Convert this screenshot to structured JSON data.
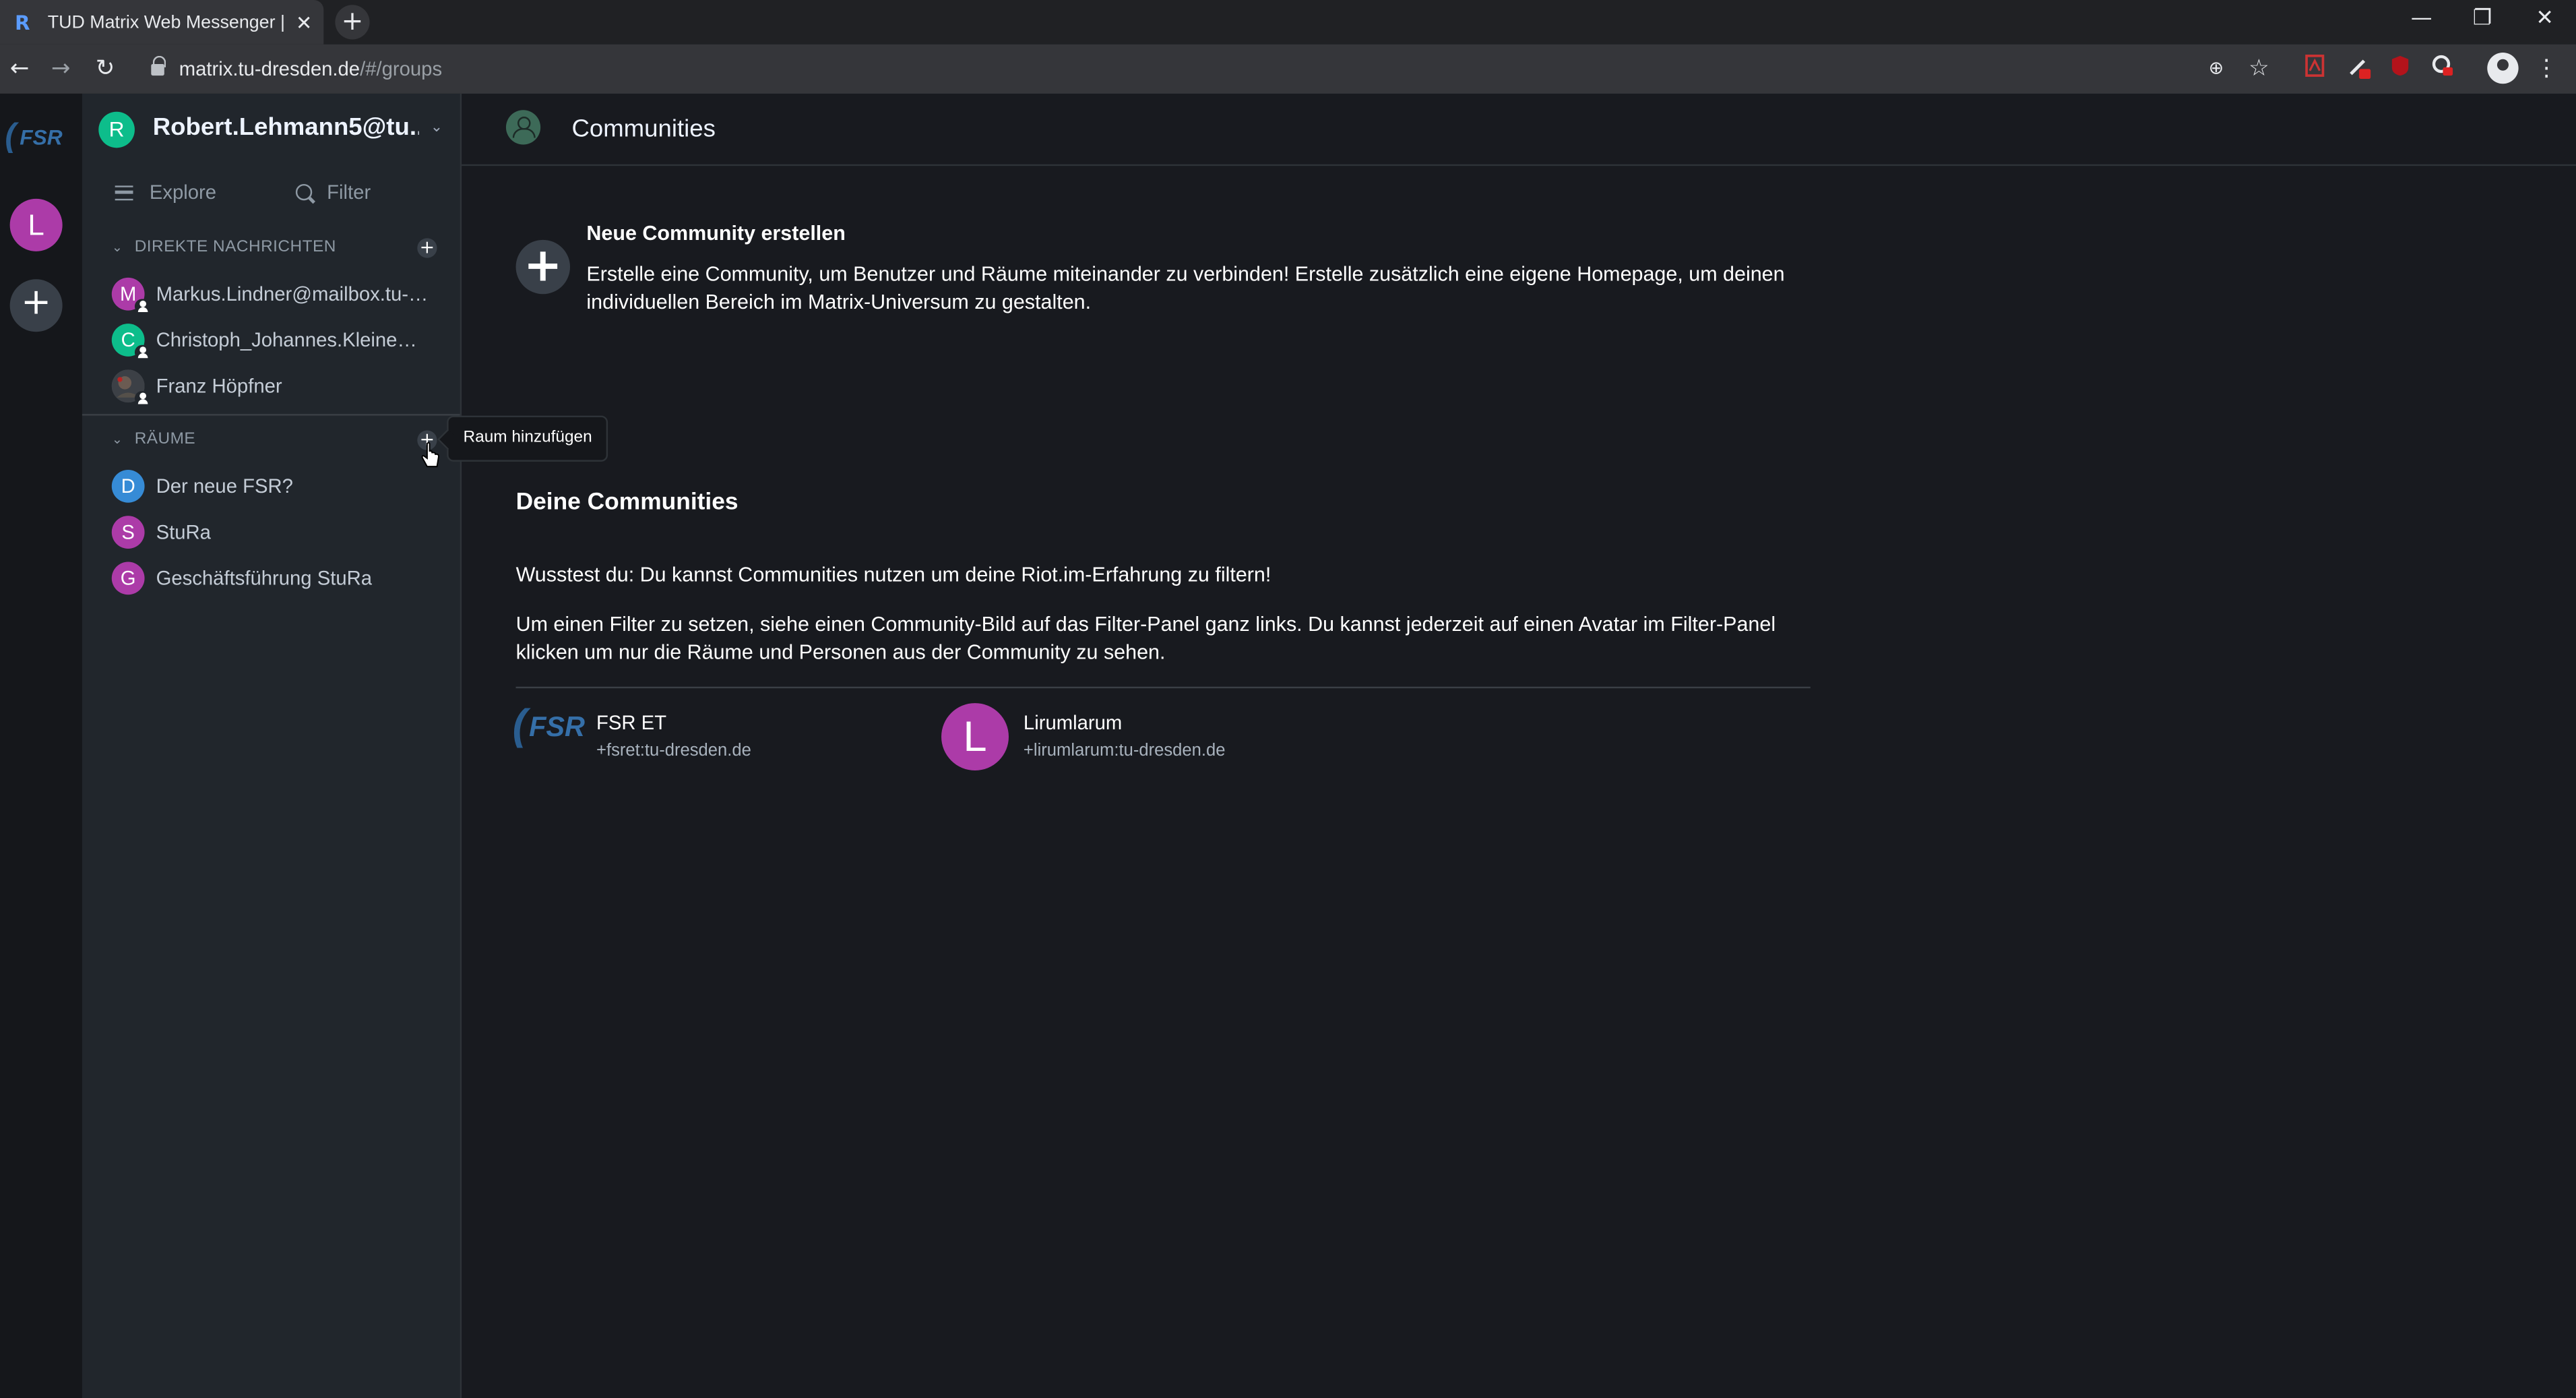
{
  "browser": {
    "tab_title": "TUD Matrix Web Messenger | De",
    "tab_favicon": "R",
    "tab_close": "✕",
    "new_tab": "+",
    "url_host": "matrix.tu-dresden.de",
    "url_path": "/#/groups",
    "window_controls": {
      "minimize": "—",
      "restore": "❐",
      "close": "✕"
    },
    "nav": {
      "back": "←",
      "forward": "→",
      "reload": "↻"
    },
    "toolbar_icons": {
      "zoom": "⊕",
      "bookmark": "☆",
      "ext_badge": "u",
      "menu": "⋮"
    }
  },
  "left_panel": {
    "community_logo_text": "FSR",
    "community_avatar_letter": "L",
    "create_button": "+"
  },
  "room_list": {
    "user_initial": "R",
    "user_name": "Robert.Lehmann5@tu...",
    "explore_label": "Explore",
    "filter_label": "Filter",
    "dm_section": "DIREKTE NACHRICHTEN",
    "dm_items": [
      {
        "initial": "M",
        "name": "Markus.Lindner@mailbox.tu-dr...",
        "color": "#ac3ba8"
      },
      {
        "initial": "C",
        "name": "Christoph_Johannes.Kleine@tu...",
        "color": "#0dbd8b"
      },
      {
        "initial": "",
        "name": "Franz Höpfner",
        "color": "#4a4f55"
      }
    ],
    "rooms_section": "RÄUME",
    "rooms": [
      {
        "initial": "D",
        "name": "Der neue FSR?",
        "color": "#368bd6"
      },
      {
        "initial": "S",
        "name": "StuRa",
        "color": "#ac3ba8"
      },
      {
        "initial": "G",
        "name": "Geschäftsführung StuRa",
        "color": "#ac3ba8"
      }
    ],
    "tooltip": "Raum hinzufügen"
  },
  "main": {
    "title": "Communities",
    "create_heading": "Neue Community erstellen",
    "create_description": "Erstelle eine Community, um Benutzer und Räume miteinander zu verbinden! Erstelle zusätzlich eine eigene Homepage, um deinen individuellen Bereich im Matrix-Universum zu gestalten.",
    "your_communities_heading": "Deine Communities",
    "tip_1": "Wusstest du: Du kannst Communities nutzen um deine Riot.im-Erfahrung zu filtern!",
    "tip_2": "Um einen Filter zu setzen, siehe einen Community-Bild auf das Filter-Panel ganz links. Du kannst jederzeit auf einen Avatar im Filter-Panel klicken um nur die Räume und Personen aus der Community zu sehen.",
    "communities": [
      {
        "logo_text": "FSR",
        "name": "FSR ET",
        "id": "+fsret:tu-dresden.de"
      },
      {
        "avatar_letter": "L",
        "name": "Lirumlarum",
        "id": "+lirumlarum:tu-dresden.de"
      }
    ]
  },
  "colors": {
    "accent_green": "#0dbd8b",
    "avatar_purple": "#ac3ba8",
    "avatar_blue": "#368bd6"
  }
}
